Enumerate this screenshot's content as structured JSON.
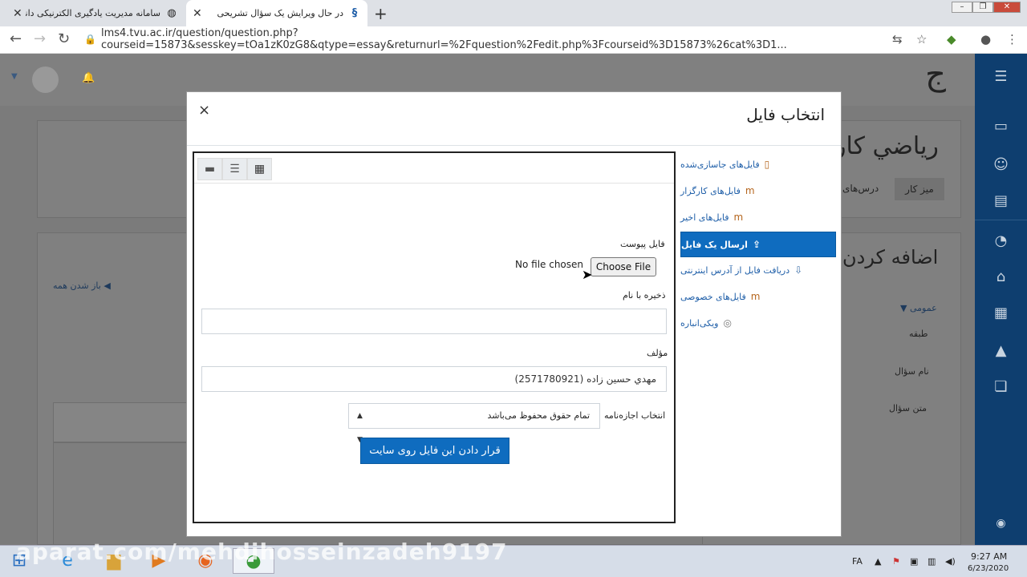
{
  "browser": {
    "tabs": [
      {
        "title": "سامانه مدیریت یادگیری الکترنیکی دانشگاه ف",
        "icon": "globe-icon"
      },
      {
        "title": "در حال ویرایش یک سؤال تشریحی",
        "icon": "moodle-icon"
      }
    ],
    "new_tab": "+",
    "close_glyph": "✕",
    "url": "lms4.tvu.ac.ir/question/question.php?courseid=15873&sesskey=tOa1zK0zG8&qtype=essay&returnurl=%2Fquestion%2Fedit.php%3Fcourseid%3D15873%26cat%3D1..."
  },
  "background": {
    "course_title": "رياضي كار",
    "breadcrumb_dashboard": "ميز كار",
    "breadcrumb_courses": "درس‌های",
    "add_heading": "اضافه کردن",
    "expand_all": "باز شدن همه",
    "section_general": "عمومی",
    "field_category": "طبقه",
    "field_question_name": "نام سؤال",
    "field_question_text": "متن سؤال"
  },
  "modal": {
    "title": "انتخاب فایل",
    "close": "×",
    "repositories": [
      {
        "label": "فایل‌های جاسازی‌شده",
        "icon": "document-icon",
        "active": false
      },
      {
        "label": "فایل‌های کارگزار",
        "icon": "moodle-icon",
        "active": false
      },
      {
        "label": "فایل‌های اخیر",
        "icon": "moodle-icon",
        "active": false
      },
      {
        "label": "ارسال یک فایل",
        "icon": "upload-icon",
        "active": true
      },
      {
        "label": "دریافت فایل از آدرس اینترنتی",
        "icon": "download-icon",
        "active": false
      },
      {
        "label": "فایل‌های خصوصی",
        "icon": "moodle-icon",
        "active": false
      },
      {
        "label": "ویکی‌انباره",
        "icon": "wiki-icon",
        "active": false
      }
    ],
    "attachment_label": "فایل پیوست",
    "no_file": "No file chosen",
    "choose_file": "Choose File",
    "save_as_label": "ذخیره با نام",
    "save_as_value": "",
    "author_label": "مؤلف",
    "author_value": "مهدي حسين زاده (2571780921)",
    "license_label": "انتخاب اجازه‌نامه",
    "license_value": "تمام حقوق محفوظ می‌باشد",
    "submit": "قرار دادن این فایل روی سایت"
  },
  "watermark": "aparat.com/mehdihosseinzadeh9197",
  "taskbar": {
    "language": "FA",
    "time": "9:27 AM",
    "date": "6/23/2020"
  },
  "colors": {
    "accent": "#0f6cbf",
    "sidebar": "#0e3e6f"
  }
}
